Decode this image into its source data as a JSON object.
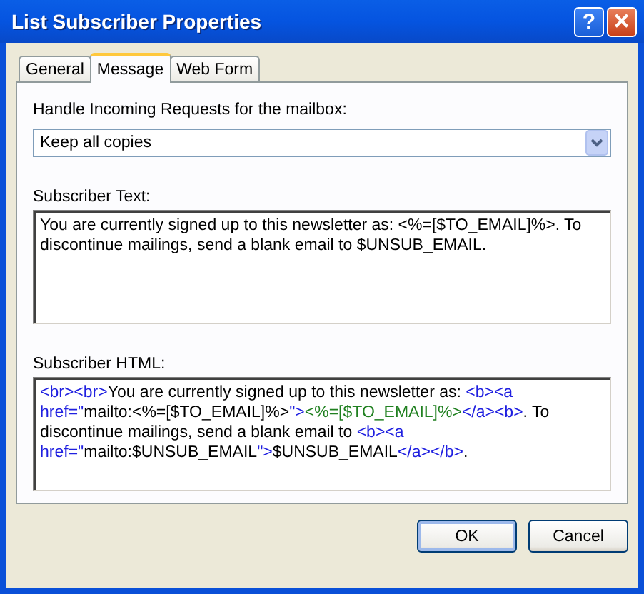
{
  "window": {
    "title": "List Subscriber Properties",
    "help_button": "?",
    "close_button": "✕"
  },
  "tabs": [
    {
      "label": "General",
      "selected": false
    },
    {
      "label": "Message",
      "selected": true
    },
    {
      "label": "Web Form",
      "selected": false
    }
  ],
  "handle_requests": {
    "label": "Handle Incoming Requests for the mailbox:",
    "value": "Keep all copies"
  },
  "subscriber_text": {
    "label": "Subscriber Text:",
    "value": "You are currently signed up to this newsletter as: <%=[$TO_EMAIL]%>. To discontinue mailings, send a blank email to $UNSUB_EMAIL."
  },
  "subscriber_html": {
    "label": "Subscriber HTML:",
    "lines": [
      [
        {
          "kind": "tag",
          "text": "<br><br>"
        },
        {
          "kind": "text",
          "text": "You are currently signed up to this newsletter as: "
        },
        {
          "kind": "tag",
          "text": "<b><a"
        }
      ],
      [
        {
          "kind": "tag",
          "text": "href=\""
        },
        {
          "kind": "text",
          "text": "mailto:<%=[$TO_EMAIL]%>"
        },
        {
          "kind": "tag",
          "text": "\">"
        },
        {
          "kind": "value",
          "text": "<%=[$TO_EMAIL]%>"
        },
        {
          "kind": "tag",
          "text": "</a><b>"
        },
        {
          "kind": "text",
          "text": ". To"
        }
      ],
      [
        {
          "kind": "text",
          "text": "discontinue mailings, send a blank email to "
        },
        {
          "kind": "tag",
          "text": "<b><a"
        }
      ],
      [
        {
          "kind": "tag",
          "text": "href=\""
        },
        {
          "kind": "text",
          "text": "mailto:$UNSUB_EMAIL"
        },
        {
          "kind": "tag",
          "text": "\">"
        },
        {
          "kind": "text",
          "text": "$UNSUB_EMAIL"
        },
        {
          "kind": "tag",
          "text": "</a></b>"
        },
        {
          "kind": "text",
          "text": "."
        }
      ]
    ]
  },
  "buttons": [
    "OK",
    "Cancel"
  ]
}
